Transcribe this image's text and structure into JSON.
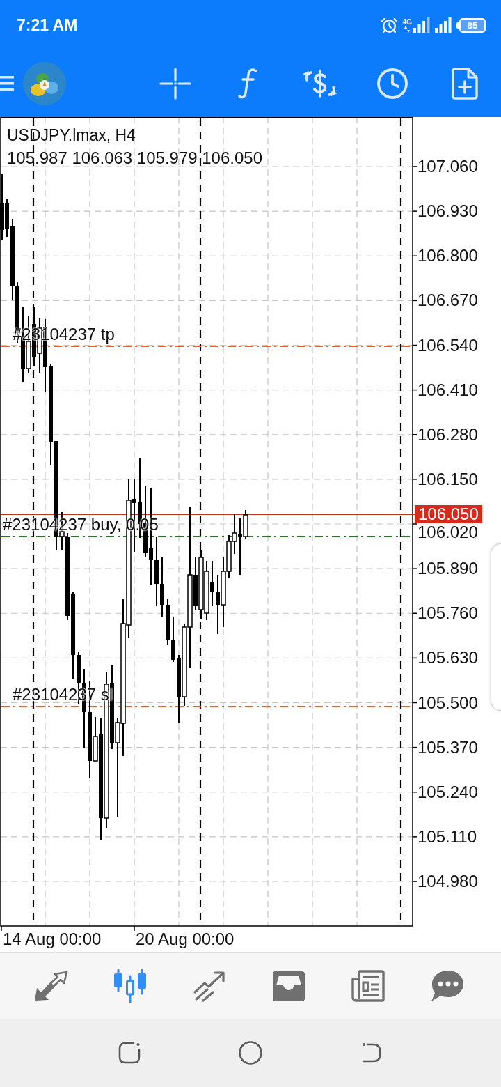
{
  "status_bar": {
    "time": "7:21 AM",
    "network": "4G",
    "battery": "85"
  },
  "chart": {
    "title": "USDJPY.lmax, H4",
    "ohlc": "105.987 106.063 105.979 106.050",
    "order_lines": [
      {
        "kind": "tp",
        "label": "#23104237 tp",
        "color": "#e2602a"
      },
      {
        "kind": "entry",
        "label": "#23104237 buy, 0.05",
        "color": "#1e7b1e"
      },
      {
        "kind": "sl",
        "label": "#23104237 sl",
        "color": "#e2602a"
      }
    ],
    "current_price": "106.050",
    "price_axis": [
      "107.060",
      "106.930",
      "106.800",
      "106.670",
      "106.540",
      "106.410",
      "106.280",
      "106.150",
      "106.020",
      "105.890",
      "105.760",
      "105.630",
      "105.500",
      "105.370",
      "105.240",
      "105.110",
      "104.980"
    ],
    "time_axis": [
      "14 Aug 00:00",
      "20 Aug 00:00"
    ]
  },
  "bottom_nav": [
    {
      "selected": false
    },
    {
      "selected": true
    },
    {
      "selected": false
    },
    {
      "selected": false
    },
    {
      "selected": false
    },
    {
      "selected": false
    }
  ]
}
